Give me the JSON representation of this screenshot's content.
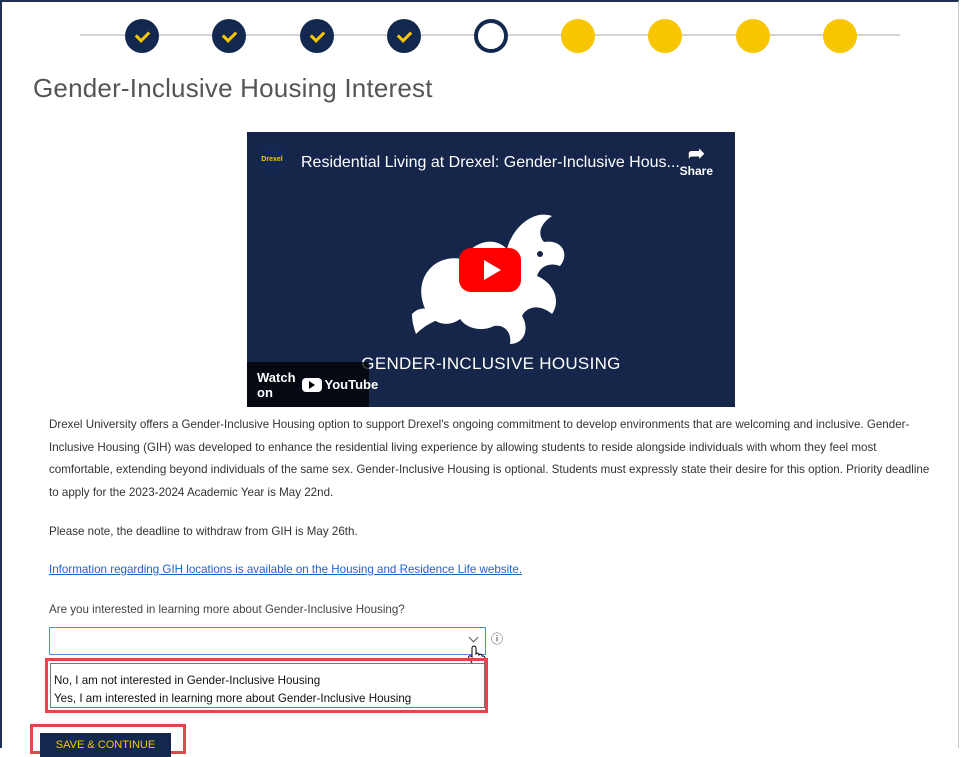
{
  "progress": {
    "steps": [
      "done",
      "done",
      "done",
      "done",
      "current",
      "todo",
      "todo",
      "todo",
      "todo"
    ]
  },
  "page_title": "Gender-Inclusive Housing Interest",
  "video": {
    "title": "Residential Living at Drexel: Gender-Inclusive Hous...",
    "share_label": "Share",
    "caption": "GENDER-INCLUSIVE HOUSING",
    "watch_on_label": "Watch on",
    "youtube_label": "YouTube",
    "logo_text": "Drexel"
  },
  "description": "Drexel University offers a Gender-Inclusive Housing option to support Drexel's ongoing commitment to develop environments that are welcoming and inclusive. Gender-Inclusive Housing (GIH) was developed to enhance the residential living experience by allowing students to reside alongside individuals with whom they feel most comfortable, extending beyond individuals of the same sex. Gender-Inclusive Housing is optional. Students must expressly state their desire for this option. Priority deadline to apply for the 2023-2024 Academic Year is May 22nd.",
  "withdraw_note": "Please note, the deadline to withdraw from GIH is May 26th.",
  "info_link": "Information regarding GIH locations is available on the Housing and Residence Life website.",
  "question": "Are you interested in learning more about Gender-Inclusive Housing?",
  "select": {
    "value": "",
    "info_icon": "ⓘ",
    "options": [
      "No, I am not interested in Gender-Inclusive Housing",
      "Yes, I am interested in learning more about Gender-Inclusive Housing"
    ]
  },
  "save_button": "SAVE & CONTINUE",
  "colors": {
    "navy": "#13284f",
    "gold": "#f7c600",
    "highlight_red": "#e0474c",
    "link_blue": "#1a66c7"
  }
}
